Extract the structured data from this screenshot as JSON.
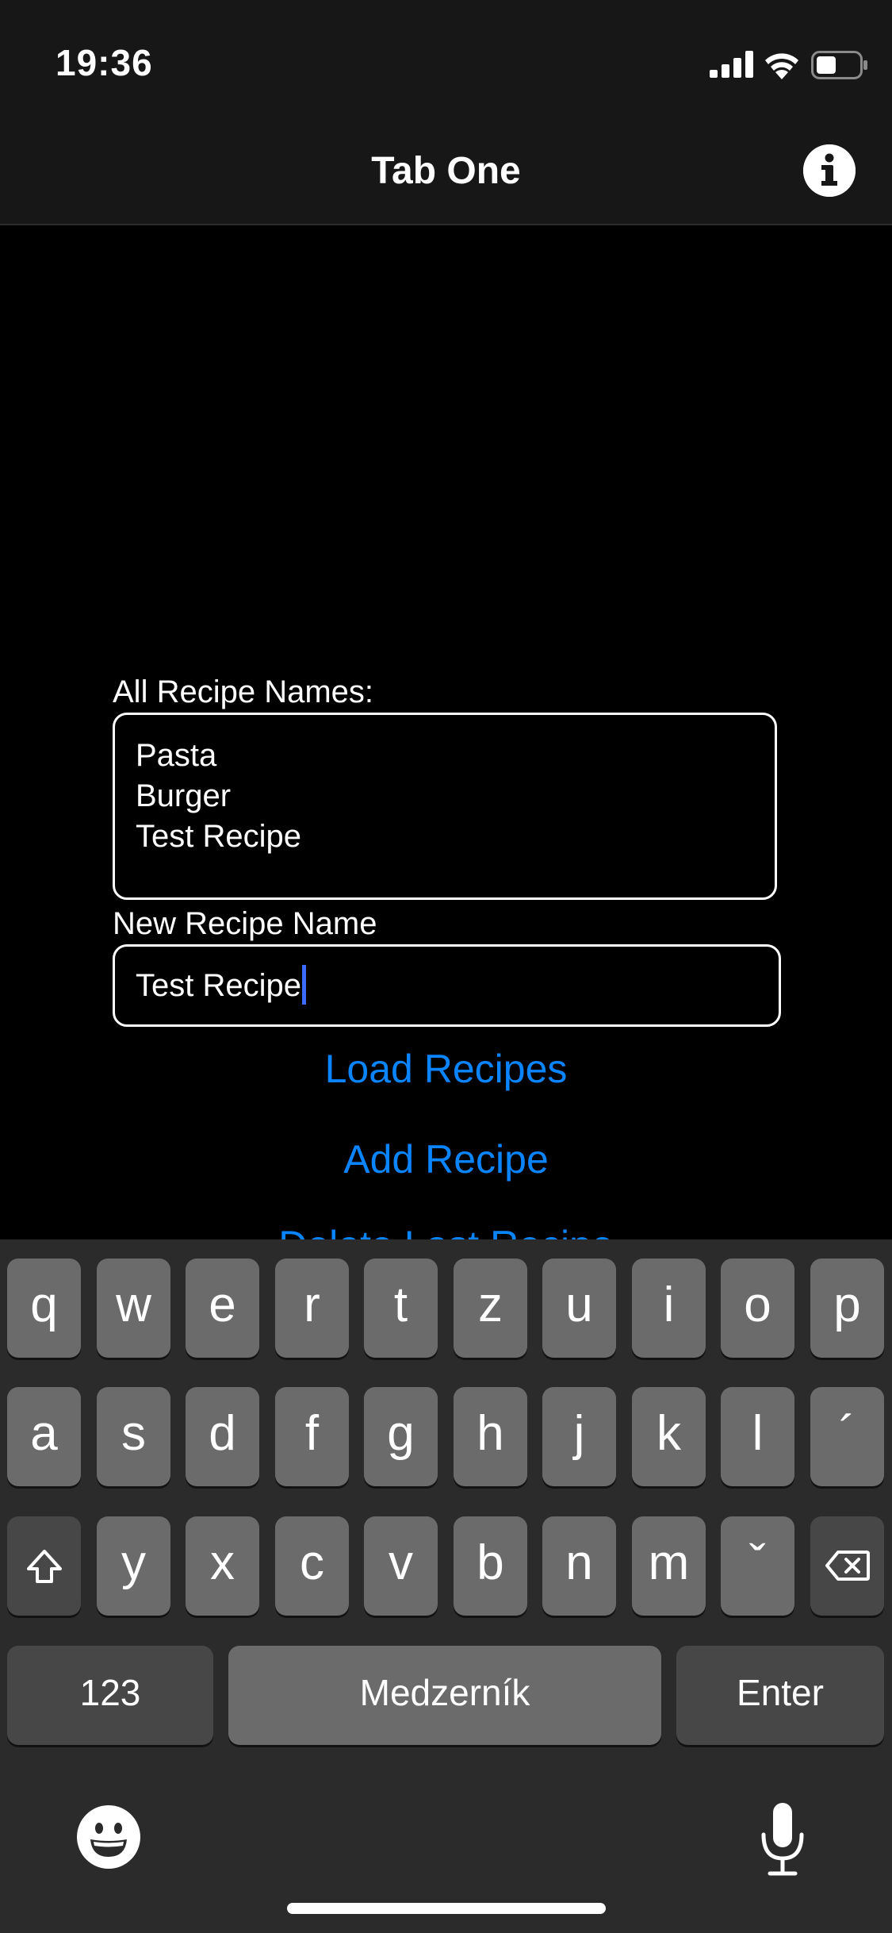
{
  "status_bar": {
    "time": "19:36",
    "icons": [
      "signal-icon",
      "wifi-icon",
      "battery-icon"
    ]
  },
  "nav": {
    "title": "Tab One",
    "info_icon": "info-icon"
  },
  "content": {
    "recipes_label": "All Recipe Names:",
    "recipes": [
      "Pasta",
      "Burger",
      "Test Recipe"
    ],
    "new_name_label": "New Recipe Name",
    "new_name_value": "Test Recipe",
    "buttons": {
      "load": "Load Recipes",
      "add": "Add Recipe",
      "delete_partial": "Delete Last Recipe"
    }
  },
  "keyboard": {
    "row1": [
      "q",
      "w",
      "e",
      "r",
      "t",
      "z",
      "u",
      "i",
      "o",
      "p"
    ],
    "row2": [
      "a",
      "s",
      "d",
      "f",
      "g",
      "h",
      "j",
      "k",
      "l",
      "´"
    ],
    "row3": [
      "y",
      "x",
      "c",
      "v",
      "b",
      "n",
      "m",
      "ˇ"
    ],
    "numbers_label": "123",
    "space_label": "Medzerník",
    "enter_label": "Enter",
    "icons": [
      "shift-icon",
      "backspace-icon",
      "emoji-icon",
      "microphone-icon"
    ]
  },
  "colors": {
    "accent": "#0a84ff",
    "background": "#000000",
    "bar_background": "#171717",
    "keyboard_background": "#2b2b2b",
    "key": "#6b6b6b",
    "special_key": "#474747"
  }
}
